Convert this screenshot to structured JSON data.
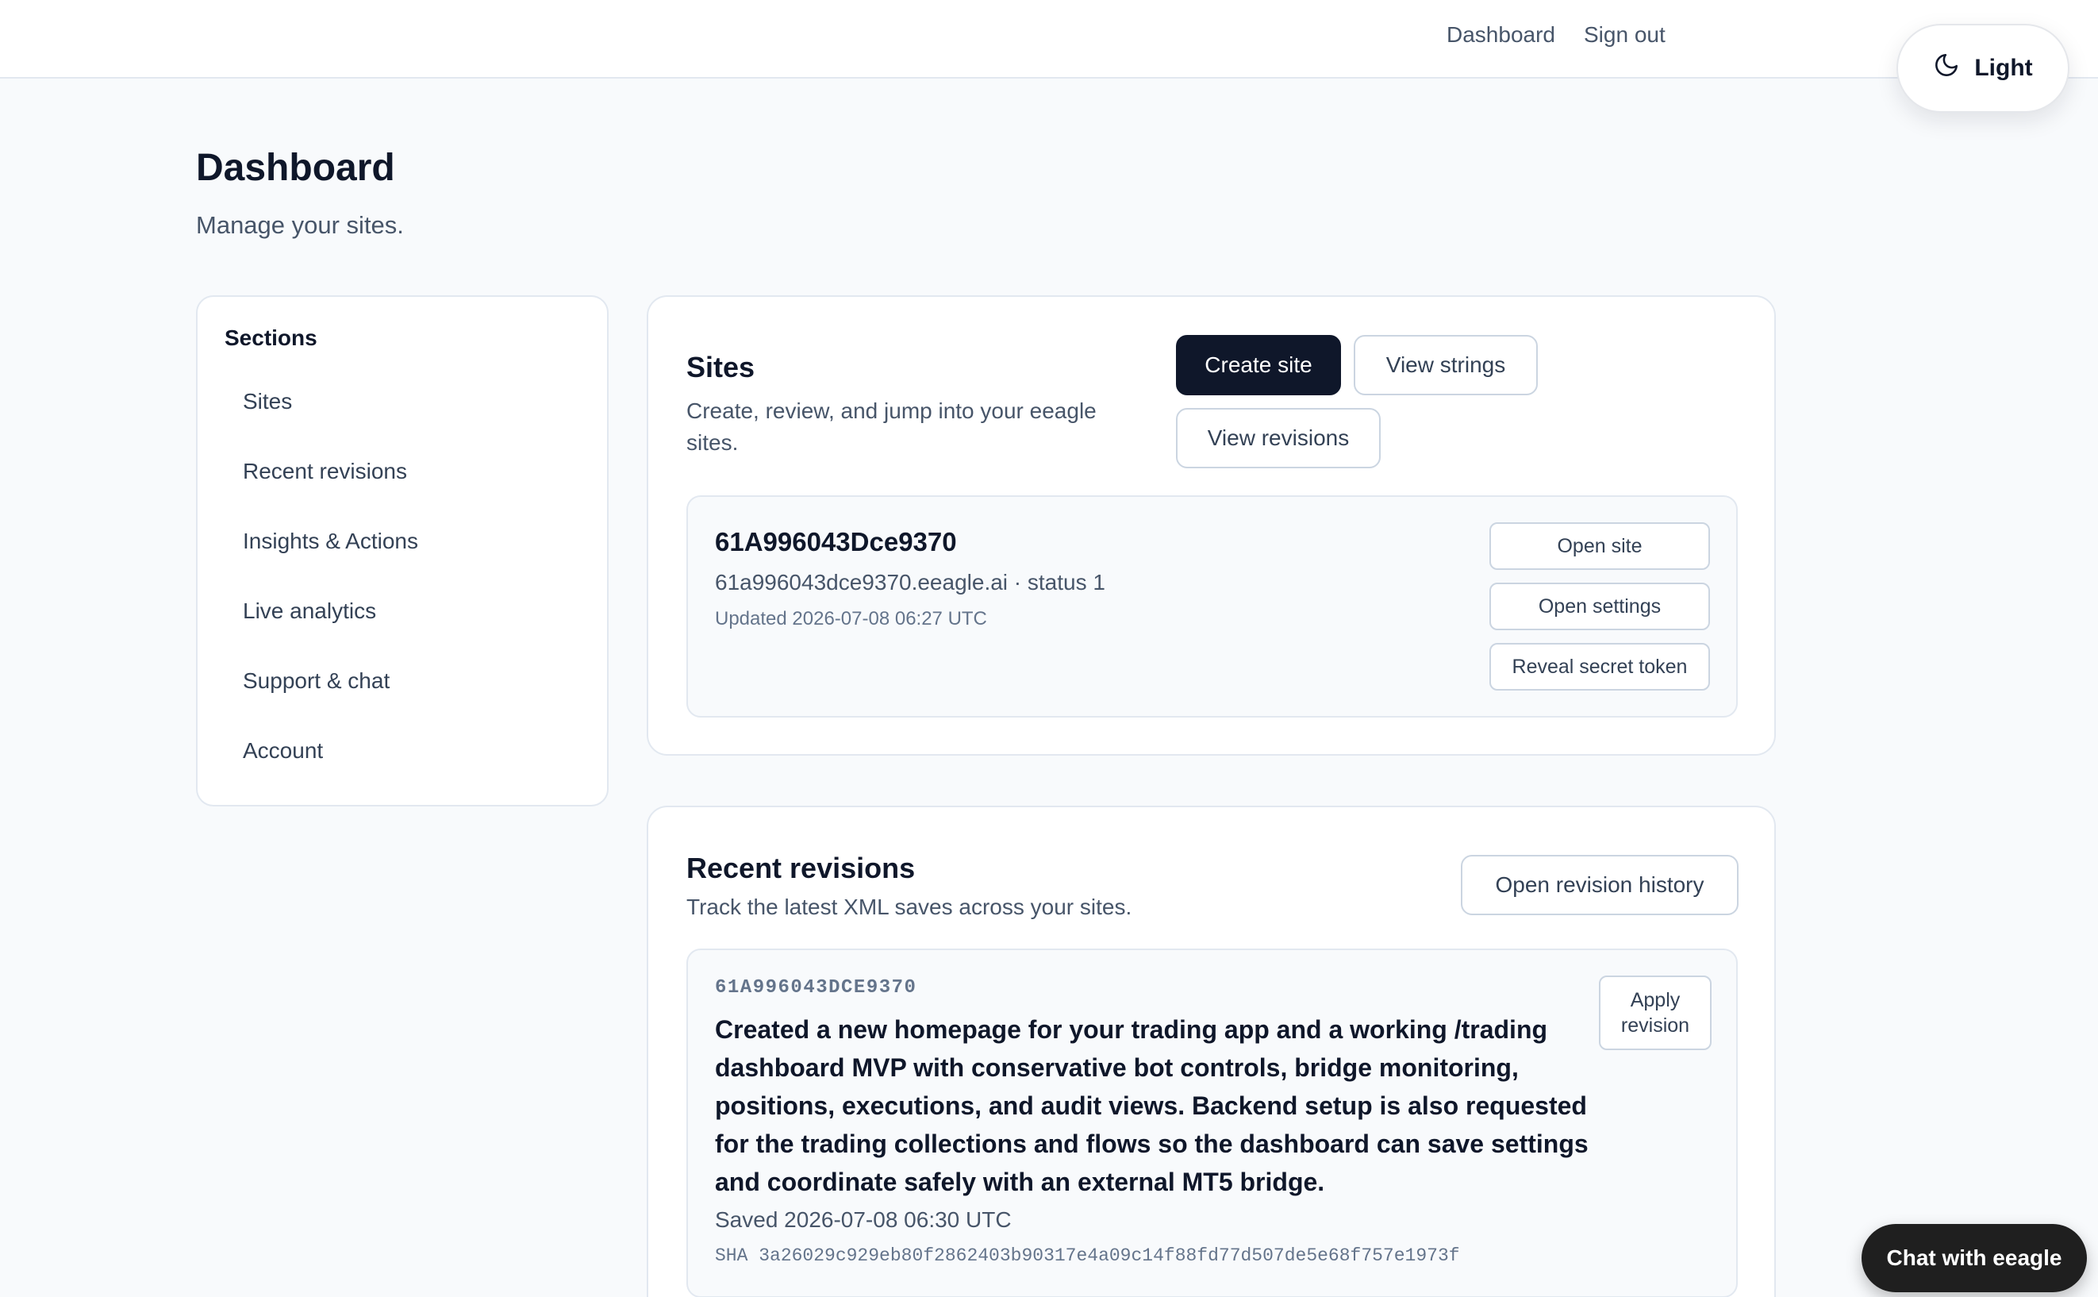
{
  "topnav": {
    "dashboard": "Dashboard",
    "signout": "Sign out"
  },
  "theme_toggle": {
    "label": "Light",
    "icon": "moon-icon"
  },
  "header": {
    "title": "Dashboard",
    "subtitle": "Manage your sites."
  },
  "sidebar": {
    "heading": "Sections",
    "items": [
      {
        "label": "Sites"
      },
      {
        "label": "Recent revisions"
      },
      {
        "label": "Insights & Actions"
      },
      {
        "label": "Live analytics"
      },
      {
        "label": "Support & chat"
      },
      {
        "label": "Account"
      }
    ]
  },
  "sites": {
    "title": "Sites",
    "description": "Create, review, and jump into your eeagle sites.",
    "create_label": "Create site",
    "strings_label": "View strings",
    "revisions_label": "View revisions",
    "site": {
      "name": "61A996043Dce9370",
      "meta": "61a996043dce9370.eeagle.ai · status 1",
      "updated": "Updated 2026-07-08 06:27 UTC",
      "open_label": "Open site",
      "settings_label": "Open settings",
      "token_label": "Reveal secret token"
    }
  },
  "revisions": {
    "title": "Recent revisions",
    "description": "Track the latest XML saves across your sites.",
    "history_label": "Open revision history",
    "item": {
      "site_id": "61A996043DCE9370",
      "summary": "Created a new homepage for your trading app and a working /trading dashboard MVP with conservative bot controls, bridge monitoring, positions, executions, and audit views. Backend setup is also requested for the trading collections and flows so the dashboard can save settings and coordinate safely with an external MT5 bridge.",
      "saved": "Saved 2026-07-08 06:30 UTC",
      "sha": "SHA 3a26029c929eb80f2862403b90317e4a09c14f88fd77d507de5e68f757e1973f",
      "apply_label": "Apply revision"
    }
  },
  "chat": {
    "label": "Chat with eeagle"
  }
}
